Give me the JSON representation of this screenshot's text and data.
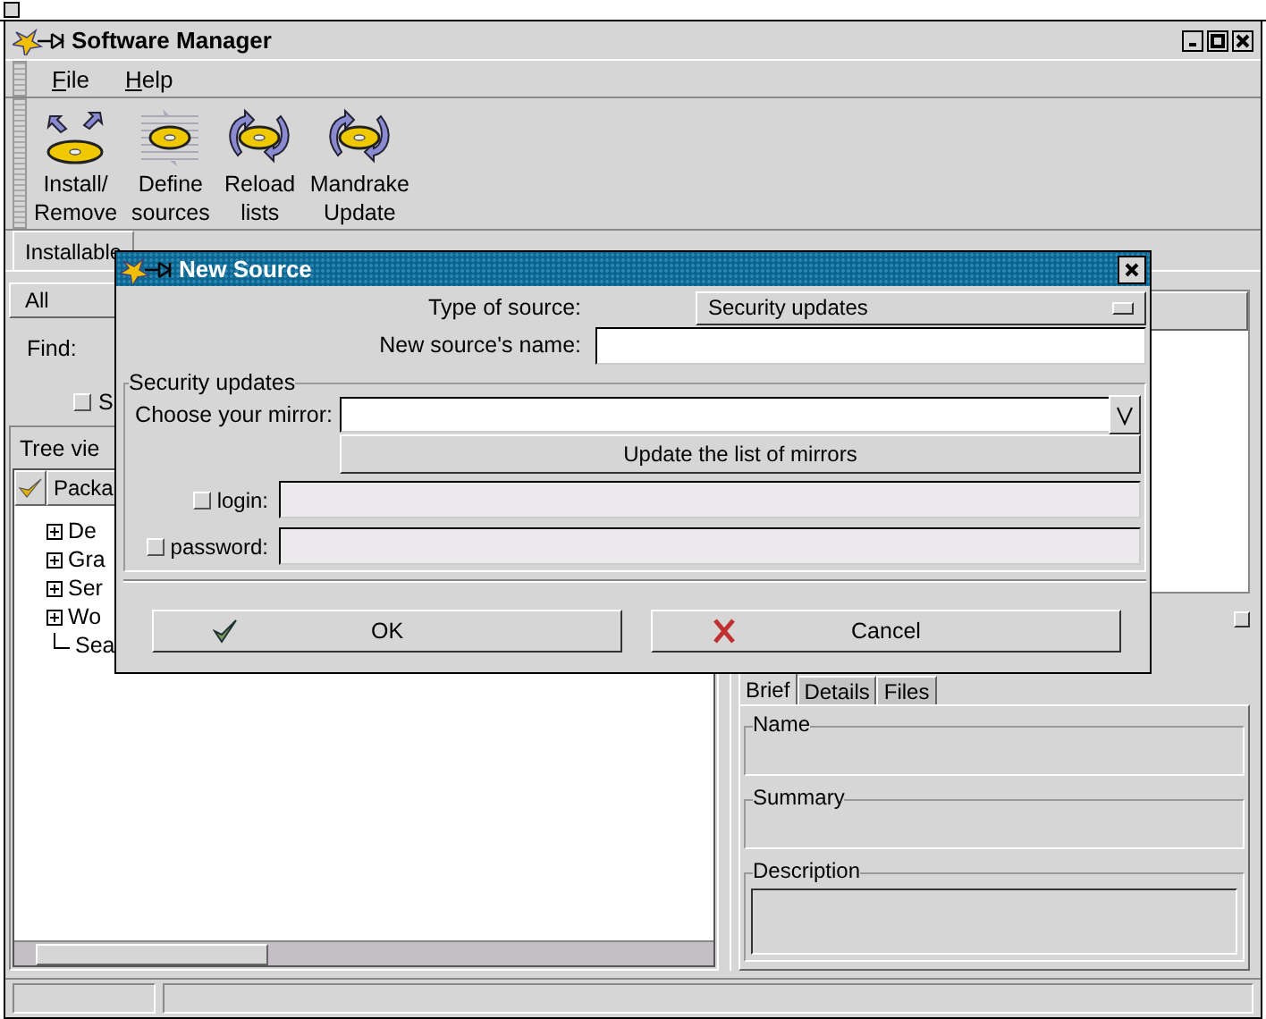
{
  "window": {
    "title": "Software Manager"
  },
  "menu": [
    {
      "label": "File"
    },
    {
      "label": "Help"
    }
  ],
  "toolbar": [
    {
      "lines": [
        "Install/",
        "Remove"
      ],
      "kind": "install"
    },
    {
      "lines": [
        "Define",
        "sources"
      ],
      "kind": "sources"
    },
    {
      "lines": [
        "Reload",
        "lists"
      ],
      "kind": "reload"
    },
    {
      "lines": [
        "Mandrake",
        "Update"
      ],
      "kind": "reload"
    }
  ],
  "main_tabs": [
    {
      "label": "Installable",
      "selected": true
    }
  ],
  "filter": {
    "value": "All"
  },
  "find": {
    "label": "Find:"
  },
  "search_option": {
    "label": "S",
    "checked": false
  },
  "view_tab": {
    "label": "Tree vie"
  },
  "tree": {
    "column": "Packa",
    "items": [
      {
        "label": "De",
        "kind": "group"
      },
      {
        "label": "Gra",
        "kind": "group"
      },
      {
        "label": "Ser",
        "kind": "group"
      },
      {
        "label": "Wo",
        "kind": "group"
      },
      {
        "label": "Sea",
        "kind": "leaf"
      }
    ]
  },
  "details": {
    "tabs": [
      {
        "label": "Brief",
        "selected": true
      },
      {
        "label": "Details",
        "selected": false
      },
      {
        "label": "Files",
        "selected": false
      }
    ],
    "groups": [
      {
        "label": "Name",
        "kind": "flat"
      },
      {
        "label": "Summary",
        "kind": "flat"
      },
      {
        "label": "Description",
        "kind": "sunken"
      }
    ]
  },
  "dialog": {
    "title": "New Source",
    "type_label": "Type of source:",
    "type_value": "Security updates",
    "name_label": "New source's name:",
    "group_title": "Security updates",
    "mirror_label": "Choose your mirror:",
    "update_button": "Update the list of mirrors",
    "auth": [
      {
        "label": "login:",
        "checked": false
      },
      {
        "label": "password:",
        "checked": false
      }
    ],
    "buttons": [
      {
        "label": "OK",
        "kind": "ok"
      },
      {
        "label": "Cancel",
        "kind": "cancel"
      }
    ]
  }
}
